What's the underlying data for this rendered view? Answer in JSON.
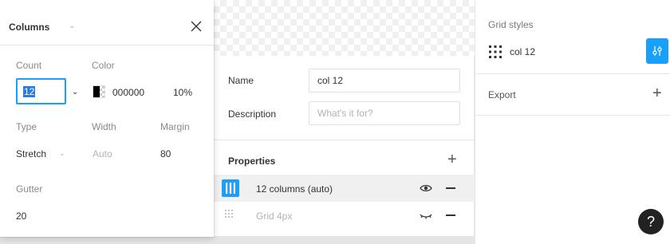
{
  "grid_panel": {
    "title": "Columns",
    "count_label": "Count",
    "count_value": "12",
    "color_label": "Color",
    "color_hex": "000000",
    "color_opacity": "10%",
    "type_label": "Type",
    "type_value": "Stretch",
    "width_label": "Width",
    "width_value": "Auto",
    "margin_label": "Margin",
    "margin_value": "80",
    "gutter_label": "Gutter",
    "gutter_value": "20"
  },
  "style_editor": {
    "name_label": "Name",
    "name_value": "col 12",
    "description_label": "Description",
    "description_placeholder": "What's it for?",
    "properties_title": "Properties",
    "properties": [
      {
        "label": "12 columns (auto)",
        "visible": true,
        "selected": true
      },
      {
        "label": "Grid 4px",
        "visible": false,
        "selected": false
      }
    ]
  },
  "right_panel": {
    "grid_styles_title": "Grid styles",
    "grid_style_name": "col 12",
    "export_title": "Export"
  },
  "help_label": "?",
  "colors": {
    "accent": "#18a0fb",
    "selection": "#2c7be5"
  }
}
